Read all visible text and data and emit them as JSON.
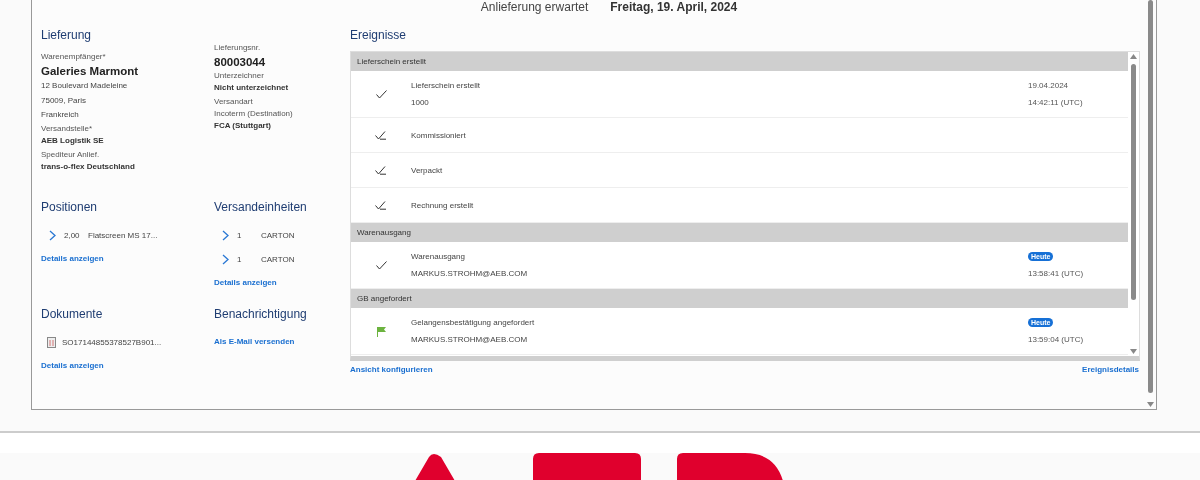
{
  "header": {
    "label": "Anlieferung erwartet",
    "value": "Freitag, 19. April, 2024"
  },
  "delivery": {
    "title": "Lieferung",
    "left": [
      {
        "kind": "label",
        "text": "Warenempfänger*"
      },
      {
        "kind": "name",
        "text": "Galeries Marmont"
      },
      {
        "kind": "line",
        "text": "12 Boulevard Madeleine"
      },
      {
        "kind": "line",
        "text": "75009, Paris"
      },
      {
        "kind": "line",
        "text": "Frankreich"
      },
      {
        "kind": "label",
        "text": "Versandstelle*"
      },
      {
        "kind": "value",
        "text": "AEB Logistik SE"
      },
      {
        "kind": "label",
        "text": "Spediteur Anlief."
      },
      {
        "kind": "value",
        "text": "trans-o-flex Deutschland"
      }
    ],
    "right": [
      {
        "kind": "label",
        "text": "Lieferungsnr."
      },
      {
        "kind": "name",
        "text": "80003044"
      },
      {
        "kind": "label",
        "text": "Unterzeichner"
      },
      {
        "kind": "value",
        "text": "Nicht unterzeichnet"
      },
      {
        "kind": "label",
        "text": "Versandart"
      },
      {
        "kind": "label",
        "text": "Incoterm (Destination)"
      },
      {
        "kind": "value",
        "text": "FCA (Stuttgart)"
      }
    ]
  },
  "positions": {
    "title": "Positionen",
    "items": [
      {
        "qty": "2,00",
        "text": "Flatscreen MS 17..."
      }
    ],
    "link": "Details anzeigen"
  },
  "shipping_units": {
    "title": "Versandeinheiten",
    "items": [
      {
        "qty": "1",
        "text": "CARTON"
      },
      {
        "qty": "1",
        "text": "CARTON"
      }
    ],
    "link": "Details anzeigen"
  },
  "documents": {
    "title": "Dokumente",
    "items": [
      {
        "text": "SO17144855378527B901..."
      }
    ],
    "link": "Details anzeigen"
  },
  "notification": {
    "title": "Benachrichtigung",
    "link": "Als E-Mail versenden"
  },
  "events": {
    "title": "Ereignisse",
    "groups": [
      {
        "title": "Lieferschein erstellt",
        "rows": [
          {
            "kind": "check",
            "title": "Lieferschein erstellt",
            "detail": "1000",
            "date": "19.04.2024",
            "time": "14:42:11 (UTC)"
          },
          {
            "kind": "check-sub",
            "title": "Kommissioniert"
          },
          {
            "kind": "check-sub",
            "title": "Verpackt"
          },
          {
            "kind": "check-sub",
            "title": "Rechnung erstellt"
          }
        ]
      },
      {
        "title": "Warenausgang",
        "rows": [
          {
            "kind": "check",
            "title": "Warenausgang",
            "detail": "MARKUS.STROHM@AEB.COM",
            "badge": "Heute",
            "time": "13:58:41 (UTC)"
          }
        ]
      },
      {
        "title": "GB angefordert",
        "rows": [
          {
            "kind": "flag",
            "title": "Gelangensbestätigung angefordert",
            "detail": "MARKUS.STROHM@AEB.COM",
            "badge": "Heute",
            "time": "13:59:04 (UTC)"
          }
        ]
      }
    ],
    "configure_link": "Ansicht konfigurieren",
    "details_link": "Ereignisdetails"
  }
}
